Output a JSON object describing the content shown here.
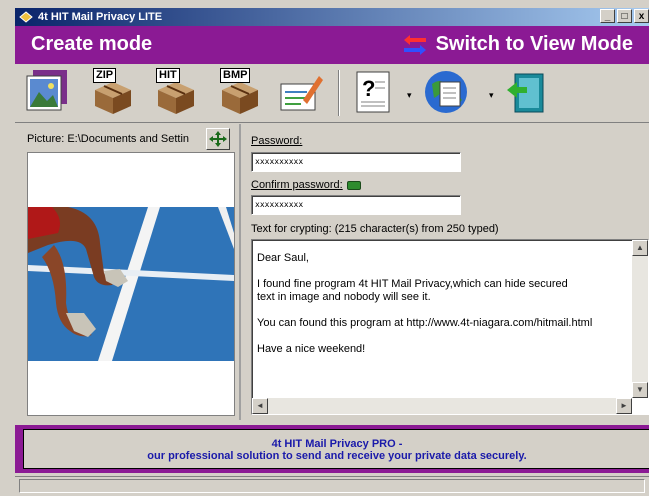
{
  "window": {
    "title": "4t HIT Mail Privacy LITE",
    "min": "_",
    "max": "□",
    "close": "x"
  },
  "modebar": {
    "left_title": "Create mode",
    "switch_label": "Switch to View Mode"
  },
  "toolbar": {
    "zip_label": "ZIP",
    "hit_label": "HIT",
    "bmp_label": "BMP",
    "dropdown_arrow": "▾"
  },
  "picture": {
    "label": "Picture: E:\\Documents and Settin"
  },
  "password": {
    "label": "Password:",
    "value": "xxxxxxxxxx",
    "confirm_label": "Confirm password:",
    "confirm_value": "xxxxxxxxxx",
    "match_color": "#2e8b2e"
  },
  "text": {
    "label": "Text for crypting: (215 character(s) from 250 typed)",
    "content": "Dear Saul,\n\nI found fine program 4t HIT Mail Privacy,which can hide secured\ntext in image and nobody will see it.\n\nYou can found this program at http://www.4t-niagara.com/hitmail.html\n\nHave a nice weekend!",
    "up": "▲",
    "down": "▼",
    "left": "◄",
    "right": "►"
  },
  "promo": {
    "line1": "4t HIT Mail Privacy PRO -",
    "line2": "our professional solution to send and receive your private data securely."
  },
  "colors": {
    "accent": "#8b1a94",
    "title_bar": "#0a246a"
  }
}
